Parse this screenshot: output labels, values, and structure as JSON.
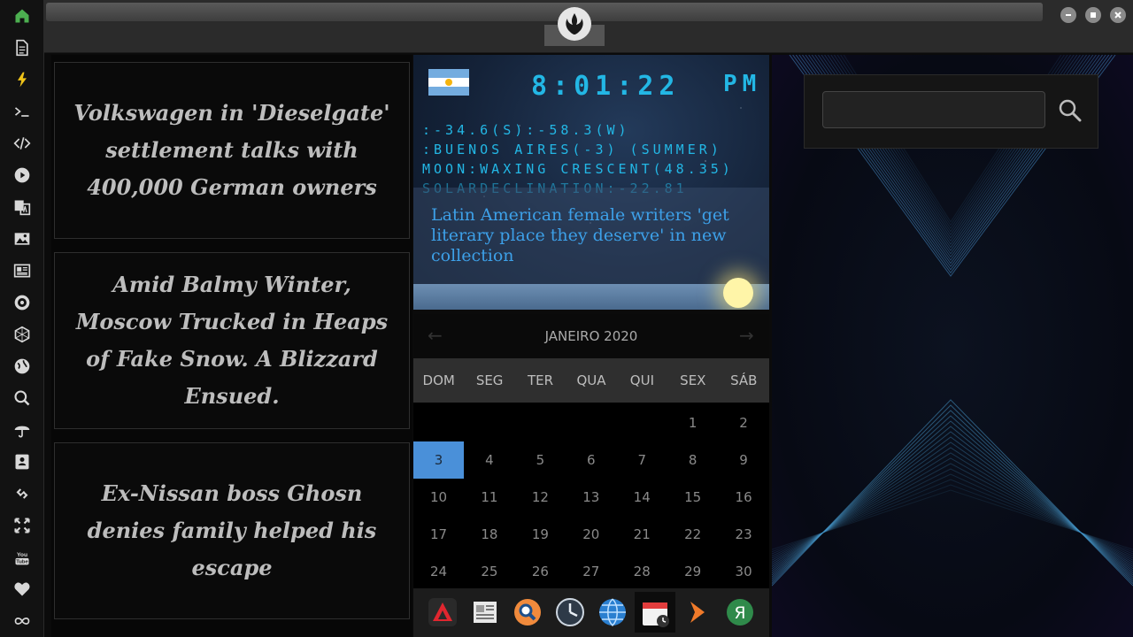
{
  "sidebar": {
    "items": [
      {
        "name": "home-icon",
        "icon": "home",
        "color": "#4caf50"
      },
      {
        "name": "document-icon",
        "icon": "document"
      },
      {
        "name": "lightning-icon",
        "icon": "lightning",
        "color": "#f0c419"
      },
      {
        "name": "terminal-icon",
        "icon": "terminal"
      },
      {
        "name": "code-icon",
        "icon": "code"
      },
      {
        "name": "play-icon",
        "icon": "play"
      },
      {
        "name": "translate-icon",
        "icon": "translate"
      },
      {
        "name": "image-icon",
        "icon": "image"
      },
      {
        "name": "newspaper-icon",
        "icon": "newspaper"
      },
      {
        "name": "emblem-icon",
        "icon": "emblem"
      },
      {
        "name": "hexagon-icon",
        "icon": "hexagon"
      },
      {
        "name": "globe-icon",
        "icon": "globe"
      },
      {
        "name": "search-icon",
        "icon": "search"
      },
      {
        "name": "umbrella-icon",
        "icon": "umbrella"
      },
      {
        "name": "contacts-icon",
        "icon": "contacts"
      },
      {
        "name": "link-icon",
        "icon": "link"
      },
      {
        "name": "expand-icon",
        "icon": "expand"
      },
      {
        "name": "youtube-icon",
        "icon": "youtube"
      },
      {
        "name": "heart-icon",
        "icon": "heart"
      },
      {
        "name": "infinity-icon",
        "icon": "infinity"
      }
    ]
  },
  "news": [
    "Volkswagen in 'Dieselgate' settlement talks with 400,000 German owners",
    "Amid Balmy Winter, Moscow Trucked in Heaps of Fake Snow. A Blizzard Ensued.",
    "Ex-Nissan boss Ghosn denies family helped his escape"
  ],
  "clock": {
    "time": "8:01:22",
    "ampm": "PM",
    "coords": ":-34.6(S):-58.3(W)",
    "location": ":BUENOS AIRES(-3) (SUMMER)",
    "moon": "MOON:WAXING CRESCENT(48.35)",
    "solar": "SOLARDECLINATION:-22.81",
    "headline": "Latin American female writers 'get literary place they deserve' in new collection"
  },
  "calendar": {
    "title": "JANEIRO 2020",
    "prev_label": "←",
    "next_label": "→",
    "weekdays": [
      "DOM",
      "SEG",
      "TER",
      "QUA",
      "QUI",
      "SEX",
      "SÁB"
    ],
    "first_weekday": 4,
    "days_in_month": 31,
    "selected_day": "3",
    "accent": "#4a90d9"
  },
  "dock": {
    "items": [
      {
        "name": "dock-app-red-icon",
        "icon": "triangle"
      },
      {
        "name": "dock-app-news-icon",
        "icon": "newspaper"
      },
      {
        "name": "dock-app-search-icon",
        "icon": "magnifier"
      },
      {
        "name": "dock-app-clock-icon",
        "icon": "clock"
      },
      {
        "name": "dock-app-globe-icon",
        "icon": "globe"
      },
      {
        "name": "dock-app-calendar-icon",
        "icon": "calendar"
      },
      {
        "name": "dock-app-arrow-icon",
        "icon": "chevron"
      },
      {
        "name": "dock-app-yandex-icon",
        "icon": "yandex"
      }
    ]
  },
  "search": {
    "value": ""
  }
}
